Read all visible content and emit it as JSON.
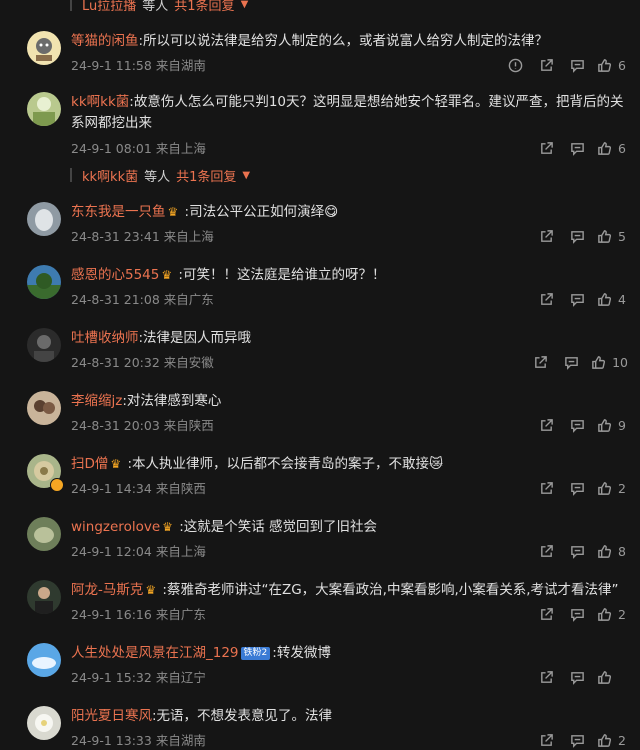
{
  "reply_summaries": [
    {
      "user": "Lu拉拉播",
      "suffix": "等人",
      "count": "共1条回复"
    },
    {
      "user": "kk啊kk菌",
      "suffix": "等人",
      "count": "共1条回复"
    }
  ],
  "comments": [
    {
      "name": "等猫的闲鱼",
      "text": ":所以可以说法律是给穷人制定的么，或者说富人给穷人制定的法律？",
      "time": "24-9-1 11:58",
      "location": "来自湖南",
      "likes": "6"
    },
    {
      "name": "kk啊kk菌",
      "text": ":故意伤人怎么可能只判10天？这明显是想给她安个轻罪名。建议严查，把背后的关系网都挖出来",
      "time": "24-9-1 08:01",
      "location": "来自上海",
      "likes": "6"
    },
    {
      "name": "东东我是一只鱼",
      "text": " :司法公平公正如何演绎",
      "emoji": "😋",
      "time": "24-8-31 23:41",
      "location": "来自上海",
      "likes": "5"
    },
    {
      "name": "感恩的心5545",
      "text": " :可笑！！这法庭是给谁立的呀？！",
      "time": "24-8-31 21:08",
      "location": "来自广东",
      "likes": "4"
    },
    {
      "name": "吐槽收纳师",
      "text": ":法律是因人而异哦",
      "time": "24-8-31 20:32",
      "location": "来自安徽",
      "likes": "10"
    },
    {
      "name": "李缩缩jz",
      "text": ":对法律感到寒心",
      "time": "24-8-31 20:03",
      "location": "来自陕西",
      "likes": "9"
    },
    {
      "name": "扫D僧",
      "text": " :本人执业律师，以后都不会接青岛的案子，不敢接",
      "emoji": "😿",
      "time": "24-9-1 14:34",
      "location": "来自陕西",
      "likes": "2"
    },
    {
      "name": "wingzerolove",
      "text": " :这就是个笑话 感觉回到了旧社会",
      "time": "24-9-1 12:04",
      "location": "来自上海",
      "likes": "8"
    },
    {
      "name": "阿龙-马斯克",
      "text": " :蔡雅奇老师讲过“在ZG，大案看政治,中案看影响,小案看关系,考试才看法律”",
      "time": "24-9-1 16:16",
      "location": "来自广东",
      "likes": "2"
    },
    {
      "name": "人生处处是风景在江湖_129",
      "tag": "铁粉2",
      "text": ":转发微博",
      "time": "24-9-1 15:32",
      "location": "来自辽宁",
      "likes": ""
    },
    {
      "name": "阳光夏日寒风",
      "text": ":无语，不想发表意见了。法律",
      "time": "24-9-1 13:33",
      "location": "来自湖南",
      "likes": "2"
    }
  ],
  "icons": {
    "report": "warning-circle-icon",
    "share": "share-icon",
    "comment": "comment-icon",
    "like": "thumbs-up-icon",
    "crown": "crown-icon"
  },
  "colors": {
    "background": "#151515",
    "username": "#eb7350",
    "meta": "#8a8a8a",
    "badge": "#f5a623"
  }
}
